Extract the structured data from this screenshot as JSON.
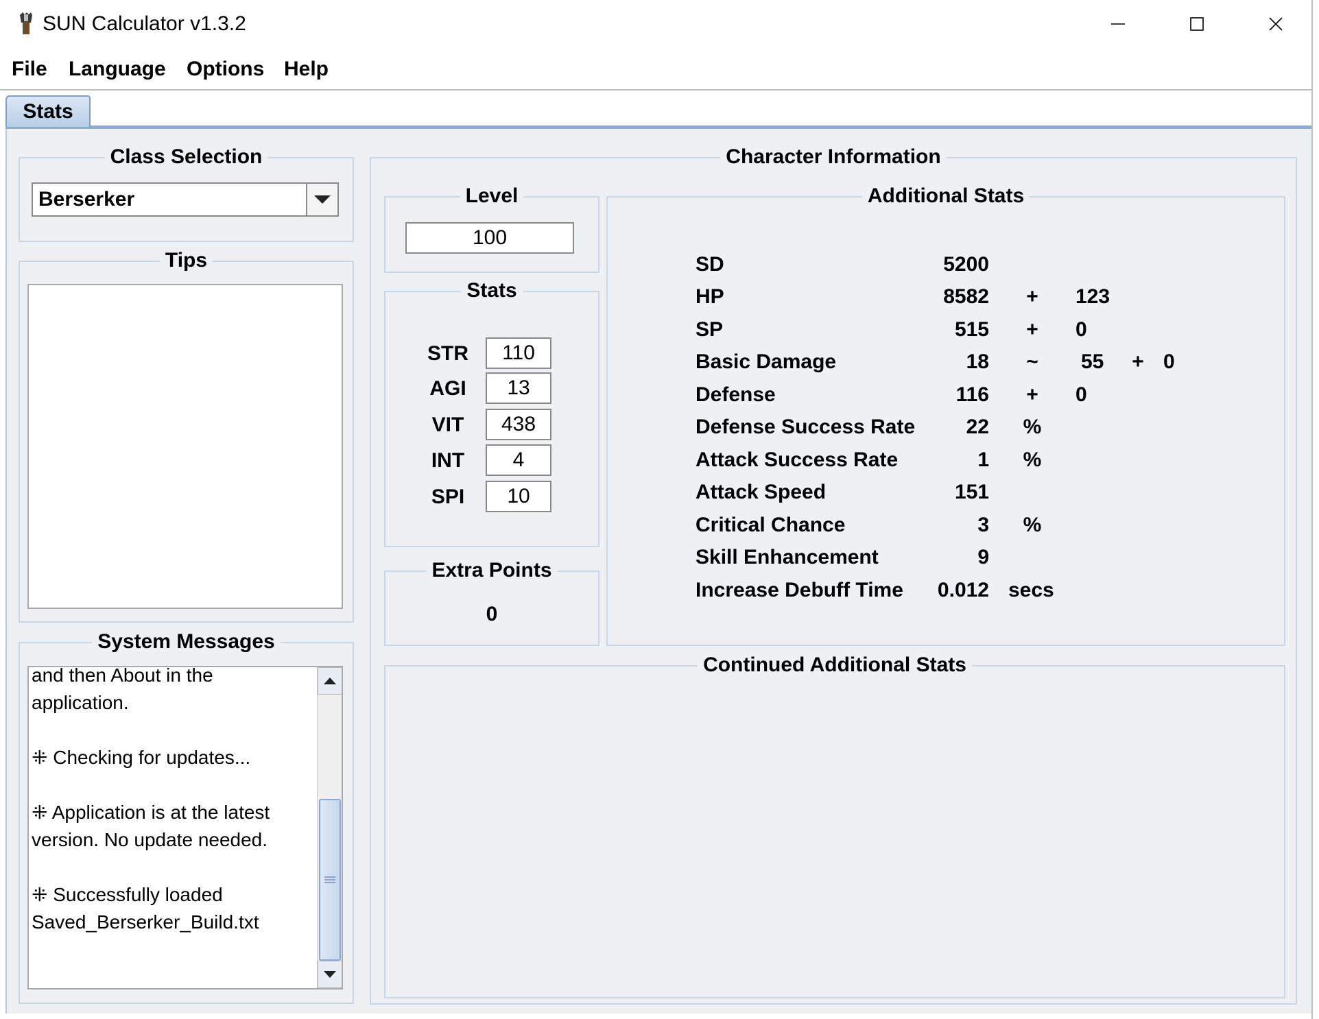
{
  "window": {
    "title": "SUN Calculator v1.3.2",
    "icon": "torch-icon"
  },
  "menu": {
    "file": "File",
    "language": "Language",
    "options": "Options",
    "help": "Help"
  },
  "tabs": {
    "stats": "Stats"
  },
  "class_selection": {
    "title": "Class Selection",
    "selected": "Berserker"
  },
  "tips": {
    "title": "Tips"
  },
  "system_messages": {
    "title": "System Messages",
    "lines": [
      "and then About in the",
      "application.",
      "",
      "⁜ Checking for updates...",
      "",
      "⁜ Application is at the latest",
      "version. No update needed.",
      "",
      "⁜ Successfully loaded",
      "Saved_Berserker_Build.txt"
    ]
  },
  "character_information": {
    "title": "Character Information",
    "level": {
      "title": "Level",
      "value": "100"
    },
    "stats": {
      "title": "Stats",
      "str_label": "STR",
      "str_value": "110",
      "agi_label": "AGI",
      "agi_value": "13",
      "vit_label": "VIT",
      "vit_value": "438",
      "int_label": "INT",
      "int_value": "4",
      "spi_label": "SPI",
      "spi_value": "10"
    },
    "extra_points": {
      "title": "Extra Points",
      "value": "0"
    },
    "additional_stats": {
      "title": "Additional Stats",
      "sd_label": "SD",
      "sd_value": "5200",
      "hp_label": "HP",
      "hp_value": "8582",
      "hp_op": "+",
      "hp_bonus": "123",
      "sp_label": "SP",
      "sp_value": "515",
      "sp_op": "+",
      "sp_bonus": "0",
      "basic_damage_label": "Basic Damage",
      "basic_damage_min": "18",
      "basic_damage_sep": "~",
      "basic_damage_max": "55",
      "basic_damage_op": "+",
      "basic_damage_bonus": "0",
      "defense_label": "Defense",
      "defense_value": "116",
      "defense_op": "+",
      "defense_bonus": "0",
      "defense_success_label": "Defense Success Rate",
      "defense_success_value": "22",
      "defense_success_unit": "%",
      "attack_success_label": "Attack Success Rate",
      "attack_success_value": "1",
      "attack_success_unit": "%",
      "attack_speed_label": "Attack Speed",
      "attack_speed_value": "151",
      "critical_chance_label": "Critical Chance",
      "critical_chance_value": "3",
      "critical_chance_unit": "%",
      "skill_enhancement_label": "Skill Enhancement",
      "skill_enhancement_value": "9",
      "debuff_time_label": "Increase Debuff Time",
      "debuff_time_value": "0.012",
      "debuff_time_unit": "secs"
    },
    "continued_additional_stats": {
      "title": "Continued Additional Stats"
    }
  }
}
